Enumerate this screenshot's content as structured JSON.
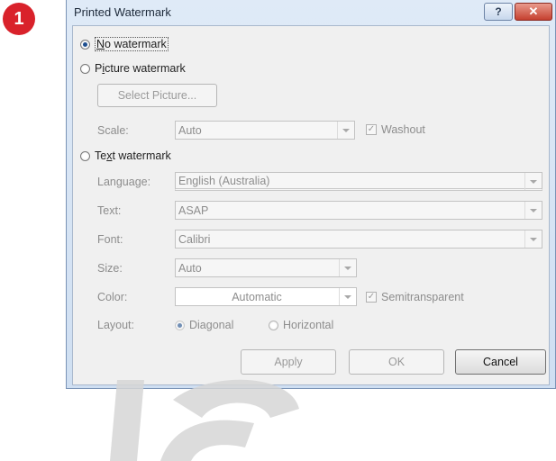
{
  "step_number": "1",
  "window": {
    "title": "Printed Watermark",
    "help_label": "?",
    "close_label": "✕"
  },
  "options": {
    "no_watermark": {
      "label_prefix": "",
      "hotkey": "N",
      "label_rest": "o watermark",
      "selected": true
    },
    "picture_watermark": {
      "label_prefix": "P",
      "hotkey": "i",
      "label_rest": "cture watermark",
      "selected": false
    },
    "text_watermark": {
      "label_prefix": "Te",
      "hotkey": "x",
      "label_rest": "t watermark",
      "selected": false
    }
  },
  "picture": {
    "select_picture_label": "Select Picture...",
    "scale_label": "Scale:",
    "scale_value": "Auto",
    "washout_label": "Washout",
    "washout_checked": true
  },
  "text": {
    "language_label": "Language:",
    "language_value": "English (Australia)",
    "text_label": "Text:",
    "text_value": "ASAP",
    "font_label": "Font:",
    "font_value": "Calibri",
    "size_label": "Size:",
    "size_value": "Auto",
    "color_label": "Color:",
    "color_value": "Automatic",
    "semitransparent_label": "Semitransparent",
    "semitransparent_checked": true,
    "layout_label": "Layout:",
    "layout_diagonal": "Diagonal",
    "layout_horizontal": "Horizontal",
    "layout_selected": "Diagonal"
  },
  "buttons": {
    "apply": "Apply",
    "ok": "OK",
    "cancel": "Cancel"
  },
  "colors": {
    "badge": "#d9222b",
    "close_button": "#c5402f",
    "titlebar": "#dfeaf7",
    "client_bg": "#f0f0f0"
  }
}
